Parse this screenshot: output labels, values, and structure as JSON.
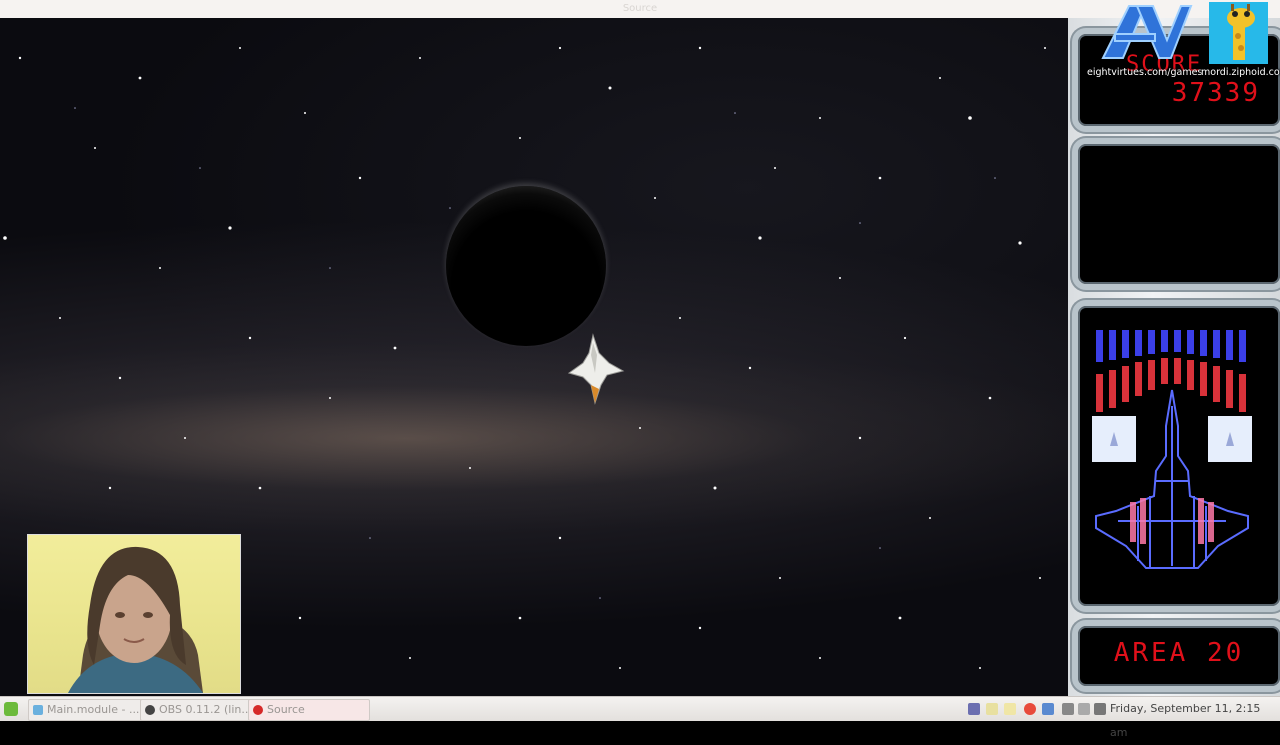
{
  "window": {
    "title": "Source"
  },
  "hud": {
    "score_label": "SCORE",
    "score_value": "37339",
    "area_text": "AREA 20"
  },
  "overlay": {
    "logo_left_url": "eightvirtues.com/games",
    "logo_right_url": "mordi.ziphoid.com"
  },
  "taskbar": {
    "tasks": [
      {
        "label": "Main.module - ..."
      },
      {
        "label": "OBS 0.11.2 (lin..."
      },
      {
        "label": "Source"
      }
    ],
    "clock": "Friday, September 11, 2:15 am"
  },
  "colors": {
    "hud_red": "#e0101a",
    "ship_blue": "#5a6cff",
    "ship_pink": "#ff7aa8",
    "energy_blue": "#3b3fe8",
    "energy_red": "#d8323a"
  }
}
